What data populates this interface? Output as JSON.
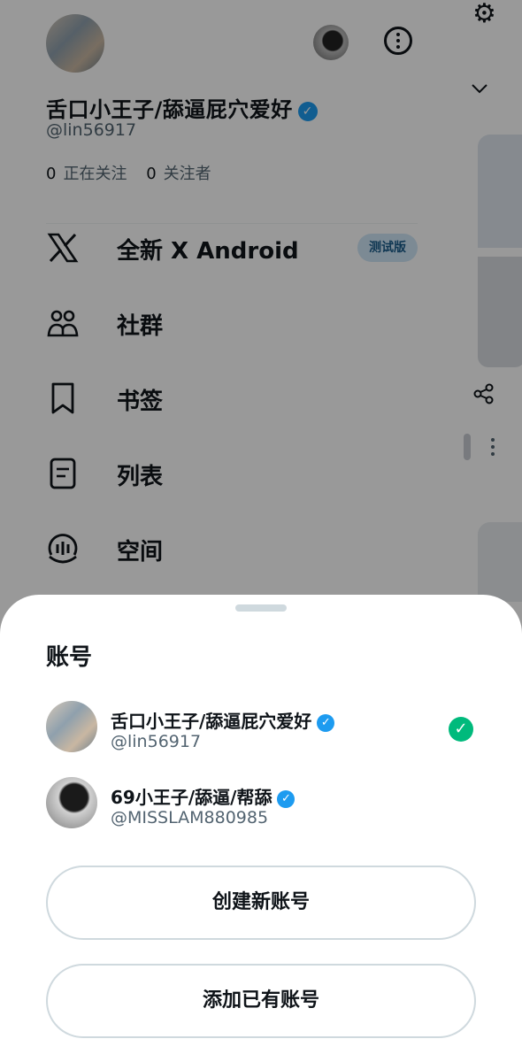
{
  "profile": {
    "name": "舌口小王子/舔逼屁穴爱好",
    "handle": "@lin56917",
    "following_count": "0",
    "following_label": "正在关注",
    "followers_count": "0",
    "followers_label": "关注者"
  },
  "menu": {
    "items": [
      {
        "label": "全新 X Android",
        "icon": "x-logo-icon",
        "badge": "测试版"
      },
      {
        "label": "社群",
        "icon": "communities-icon"
      },
      {
        "label": "书签",
        "icon": "bookmark-icon"
      },
      {
        "label": "列表",
        "icon": "list-icon"
      },
      {
        "label": "空间",
        "icon": "spaces-icon"
      }
    ]
  },
  "sheet": {
    "title": "账号",
    "accounts": [
      {
        "name": "舌口小王子/舔逼屁穴爱好",
        "handle": "@lin56917",
        "selected": true
      },
      {
        "name": "69小王子/舔逼/帮舔",
        "handle": "@MISSLAM880985",
        "selected": false
      }
    ],
    "create_label": "创建新账号",
    "add_label": "添加已有账号"
  },
  "colors": {
    "accent": "#1d9bf0",
    "success": "#00ba7c",
    "text": "#0f1419",
    "muted": "#536471"
  }
}
